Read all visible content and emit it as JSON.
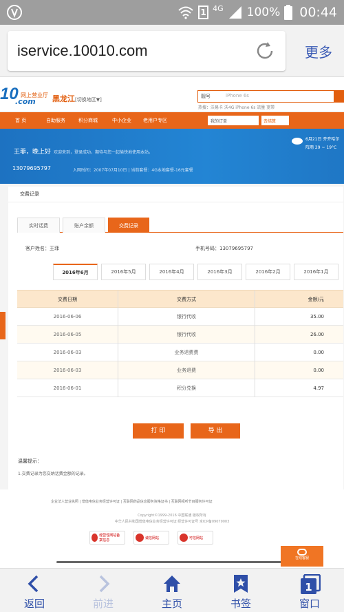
{
  "status_bar": {
    "network": "4G",
    "sim": "1",
    "battery": "100%",
    "time": "00:44"
  },
  "browser": {
    "url": "iservice.10010.com",
    "more_label": "更多"
  },
  "site": {
    "logo_num": "10",
    "logo_com": ".com",
    "logo_sub": "网上营业厅",
    "region": "黑龙江",
    "region_switch": "[切换地区▼]",
    "search_select": "靓号",
    "search_placeholder": "iPhone 6s",
    "hot_words": "热搜：沃易卡 沃4G iPhone 6s 流量 宽带",
    "nav": [
      "首 页",
      "自助服务",
      "积分商城",
      "中小企业",
      "老用户专区"
    ],
    "nav_dropdown": "我的订单",
    "nav_cart": "去结算"
  },
  "banner": {
    "greeting": "王菲，晚上好",
    "greeting_sub": "欢迎来到，登录成功，期待与您一起愉快地使用本站。",
    "phone": "13079695797",
    "join_info": "入网时间：2007年07月10日 | 当前套餐：4G本地套餐-16元套餐",
    "weather_date": "6月21日 齐齐哈尔",
    "weather_temp": "阵雨 29 ~ 19°C"
  },
  "record": {
    "title": "交费记录",
    "tabs": [
      "实时话费",
      "账户余额",
      "交费记录"
    ],
    "customer_label": "客户姓名：王菲",
    "mobile_label": "手机号码：13079695797",
    "months": [
      "2016年6月",
      "2016年5月",
      "2016年4月",
      "2016年3月",
      "2016年2月",
      "2016年1月"
    ],
    "columns": [
      "交费日期",
      "交费方式",
      "金额/元"
    ],
    "rows": [
      {
        "date": "2016-06-06",
        "method": "银行代收",
        "amount": "35.00"
      },
      {
        "date": "2016-06-05",
        "method": "银行代收",
        "amount": "26.00"
      },
      {
        "date": "2016-06-03",
        "method": "业务退费费",
        "amount": "0.00"
      },
      {
        "date": "2016-06-03",
        "method": "业务退费",
        "amount": "0.00"
      },
      {
        "date": "2016-06-01",
        "method": "积分兑换",
        "amount": "4.97"
      }
    ],
    "print_label": "打 印",
    "export_label": "导 出",
    "tips_title": "温馨提示：",
    "tips_1": "1.交费记录为您交纳话费金额的记录。"
  },
  "footer": {
    "links": "企业法人营业执照 | 增值电信业务经营许可证 | 互联网药品信息服务资格证书 | 互联网视听节目服务许可证",
    "copyright": "Copyright©1999-2016  中国联通 版权所有",
    "license": "中华人民共和国增值电信业务经营许可证 经营许可证号 京ICP备09079003",
    "badges": [
      "经营性网站备案信息",
      "诚信网站",
      "可信网站"
    ],
    "chat_label": "在线客服"
  },
  "bottom_bar": [
    "返回",
    "前进",
    "主页",
    "书签",
    "窗口"
  ],
  "colors": {
    "accent": "#e8661a",
    "brand_blue": "#1a6fbf",
    "browser_blue": "#2f4fa8"
  }
}
